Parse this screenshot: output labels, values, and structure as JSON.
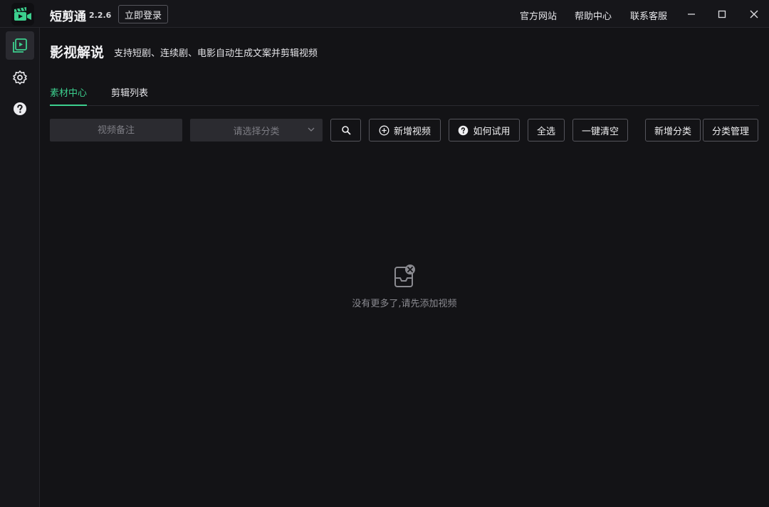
{
  "app": {
    "name": "短剪通",
    "version": "2.2.6",
    "login_label": "立即登录"
  },
  "header_links": [
    "官方网站",
    "帮助中心",
    "联系客服"
  ],
  "window_controls": {
    "minimize": "minimize-icon",
    "maximize": "maximize-icon",
    "close": "close-icon"
  },
  "sidebar": {
    "items": [
      {
        "icon": "video-library-icon",
        "active": true
      },
      {
        "icon": "gear-icon",
        "active": false
      },
      {
        "icon": "help-icon",
        "active": false
      }
    ]
  },
  "page": {
    "title": "影视解说",
    "subtitle": "支持短剧、连续剧、电影自动生成文案并剪辑视频"
  },
  "tabs": [
    {
      "label": "素材中心",
      "active": true
    },
    {
      "label": "剪辑列表",
      "active": false
    }
  ],
  "toolbar": {
    "note_placeholder": "视频备注",
    "category_placeholder": "请选择分类",
    "add_video_label": "新增视频",
    "how_to_try_label": "如何试用",
    "select_all_label": "全选",
    "clear_all_label": "一键清空",
    "add_category_label": "新增分类",
    "manage_category_label": "分类管理"
  },
  "empty_state": {
    "icon": "empty-inbox-icon",
    "message": "没有更多了,请先添加视频"
  },
  "colors": {
    "accent": "#3ccf8e",
    "background": "#131316",
    "panel": "#16161a"
  }
}
